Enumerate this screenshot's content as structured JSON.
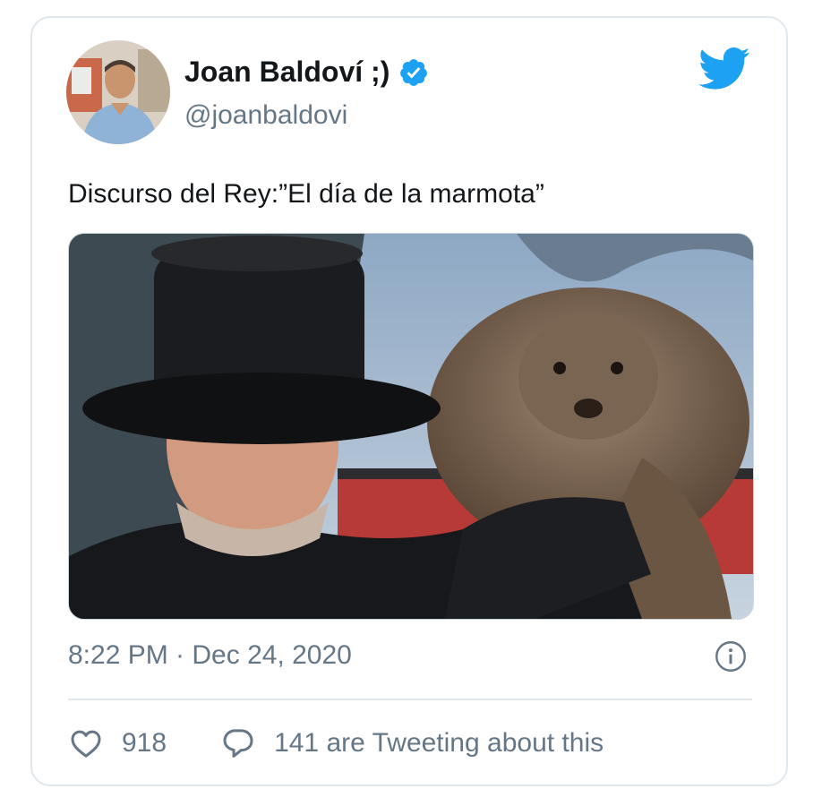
{
  "author": {
    "display_name": "Joan Baldoví ;)",
    "handle": "@joanbaldovi",
    "verified": true
  },
  "tweet": {
    "text": "Discurso del Rey:”El día de la marmota”",
    "timestamp": "8:22 PM · Dec 24, 2020"
  },
  "engagement": {
    "likes": "918",
    "tweeting_label": "141 are Tweeting about this"
  },
  "icons": {
    "verified": "verified-badge-icon",
    "brand": "twitter-bird-icon",
    "info": "info-icon",
    "like": "heart-icon",
    "reply": "speech-bubble-icon"
  },
  "colors": {
    "brand_blue": "#1da1f2",
    "secondary_text": "#657786",
    "divider": "#e1e8ed"
  }
}
